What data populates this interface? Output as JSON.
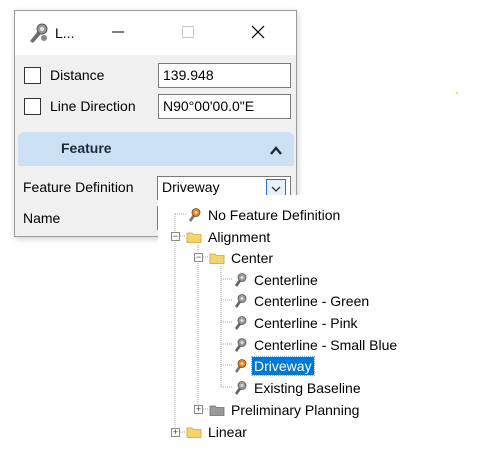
{
  "window": {
    "title": "L...",
    "distance_label": "Distance",
    "distance_value": "139.948",
    "direction_label": "Line Direction",
    "direction_value": "N90°00'00.0\"E",
    "section_title": "Feature",
    "feature_def_label": "Feature Definition",
    "feature_def_value": "Driveway",
    "name_label": "Name",
    "name_value": ""
  },
  "tree": {
    "no_feature": "No Feature Definition",
    "alignment": "Alignment",
    "center": "Center",
    "items": [
      "Centerline",
      "Centerline - Green",
      "Centerline - Pink",
      "Centerline - Small Blue",
      "Driveway",
      "Existing Baseline"
    ],
    "preliminary": "Preliminary Planning",
    "linear": "Linear",
    "selected": "Driveway"
  },
  "colors": {
    "selection": "#0078d7",
    "section_header": "#cce0f4",
    "folder": "#f6d36b"
  },
  "icons": {
    "app": "tool-settings-icon",
    "minimize": "minimize-icon",
    "maximize": "maximize-icon",
    "close": "close-icon",
    "collapse": "chevron-up-icon",
    "dropdown": "chevron-down-icon",
    "feature": "feature-definition-icon",
    "folder": "folder-icon"
  }
}
